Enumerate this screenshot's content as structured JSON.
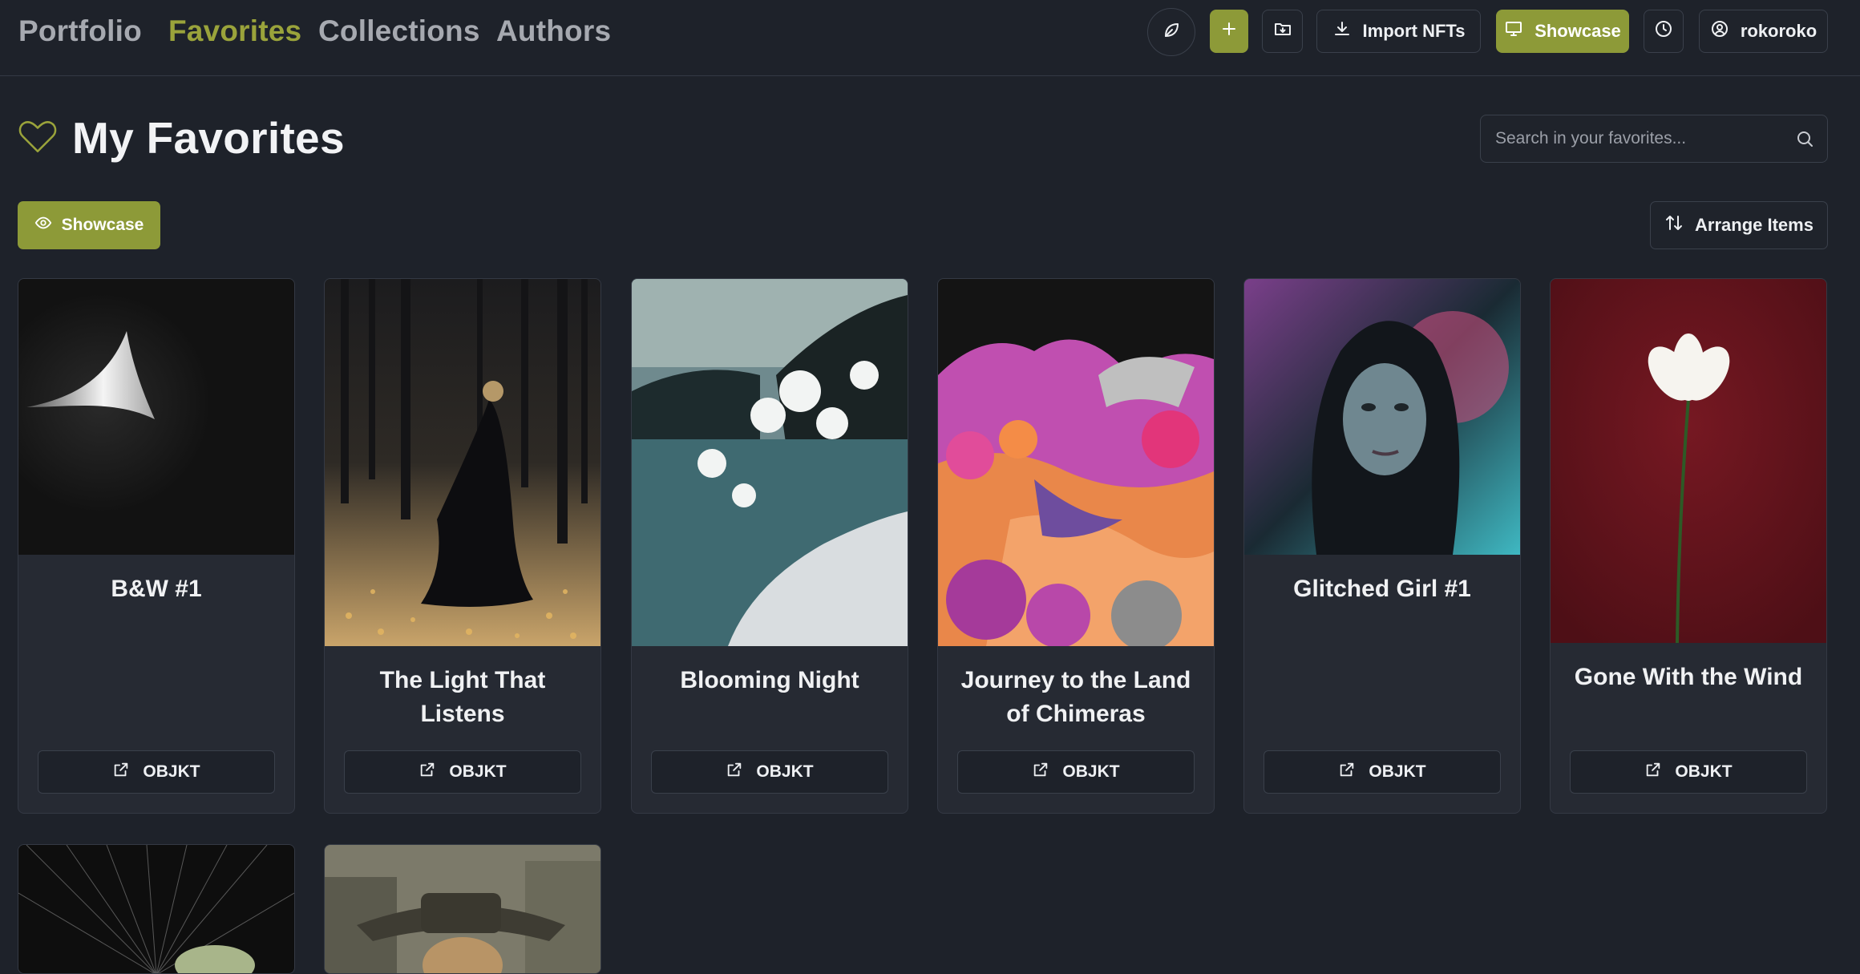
{
  "nav": {
    "links": [
      "Portfolio",
      "Favorites",
      "Collections",
      "Authors"
    ],
    "active": "Favorites"
  },
  "toolbar": {
    "leaf_icon": "leaf-icon",
    "add_icon": "plus-icon",
    "folder_icon": "folder-import-icon",
    "import_label": "Import NFTs",
    "showcase_label": "Showcase",
    "history_icon": "clock-icon",
    "user_label": "rokoroko"
  },
  "page": {
    "title": "My Favorites",
    "search_placeholder": "Search in your favorites...",
    "showcase_label": "Showcase",
    "arrange_label": "Arrange Items"
  },
  "cards": [
    {
      "title": "B&W #1",
      "button": "OBJKT"
    },
    {
      "title": "The Light That Listens",
      "button": "OBJKT"
    },
    {
      "title": "Blooming Night",
      "button": "OBJKT"
    },
    {
      "title": "Journey to the Land of Chimeras",
      "button": "OBJKT"
    },
    {
      "title": "Glitched Girl #1",
      "button": "OBJKT"
    },
    {
      "title": "Gone With the Wind",
      "button": "OBJKT"
    }
  ],
  "colors": {
    "accent": "#8d9a38",
    "background": "#1e222a",
    "card": "#262a33"
  }
}
